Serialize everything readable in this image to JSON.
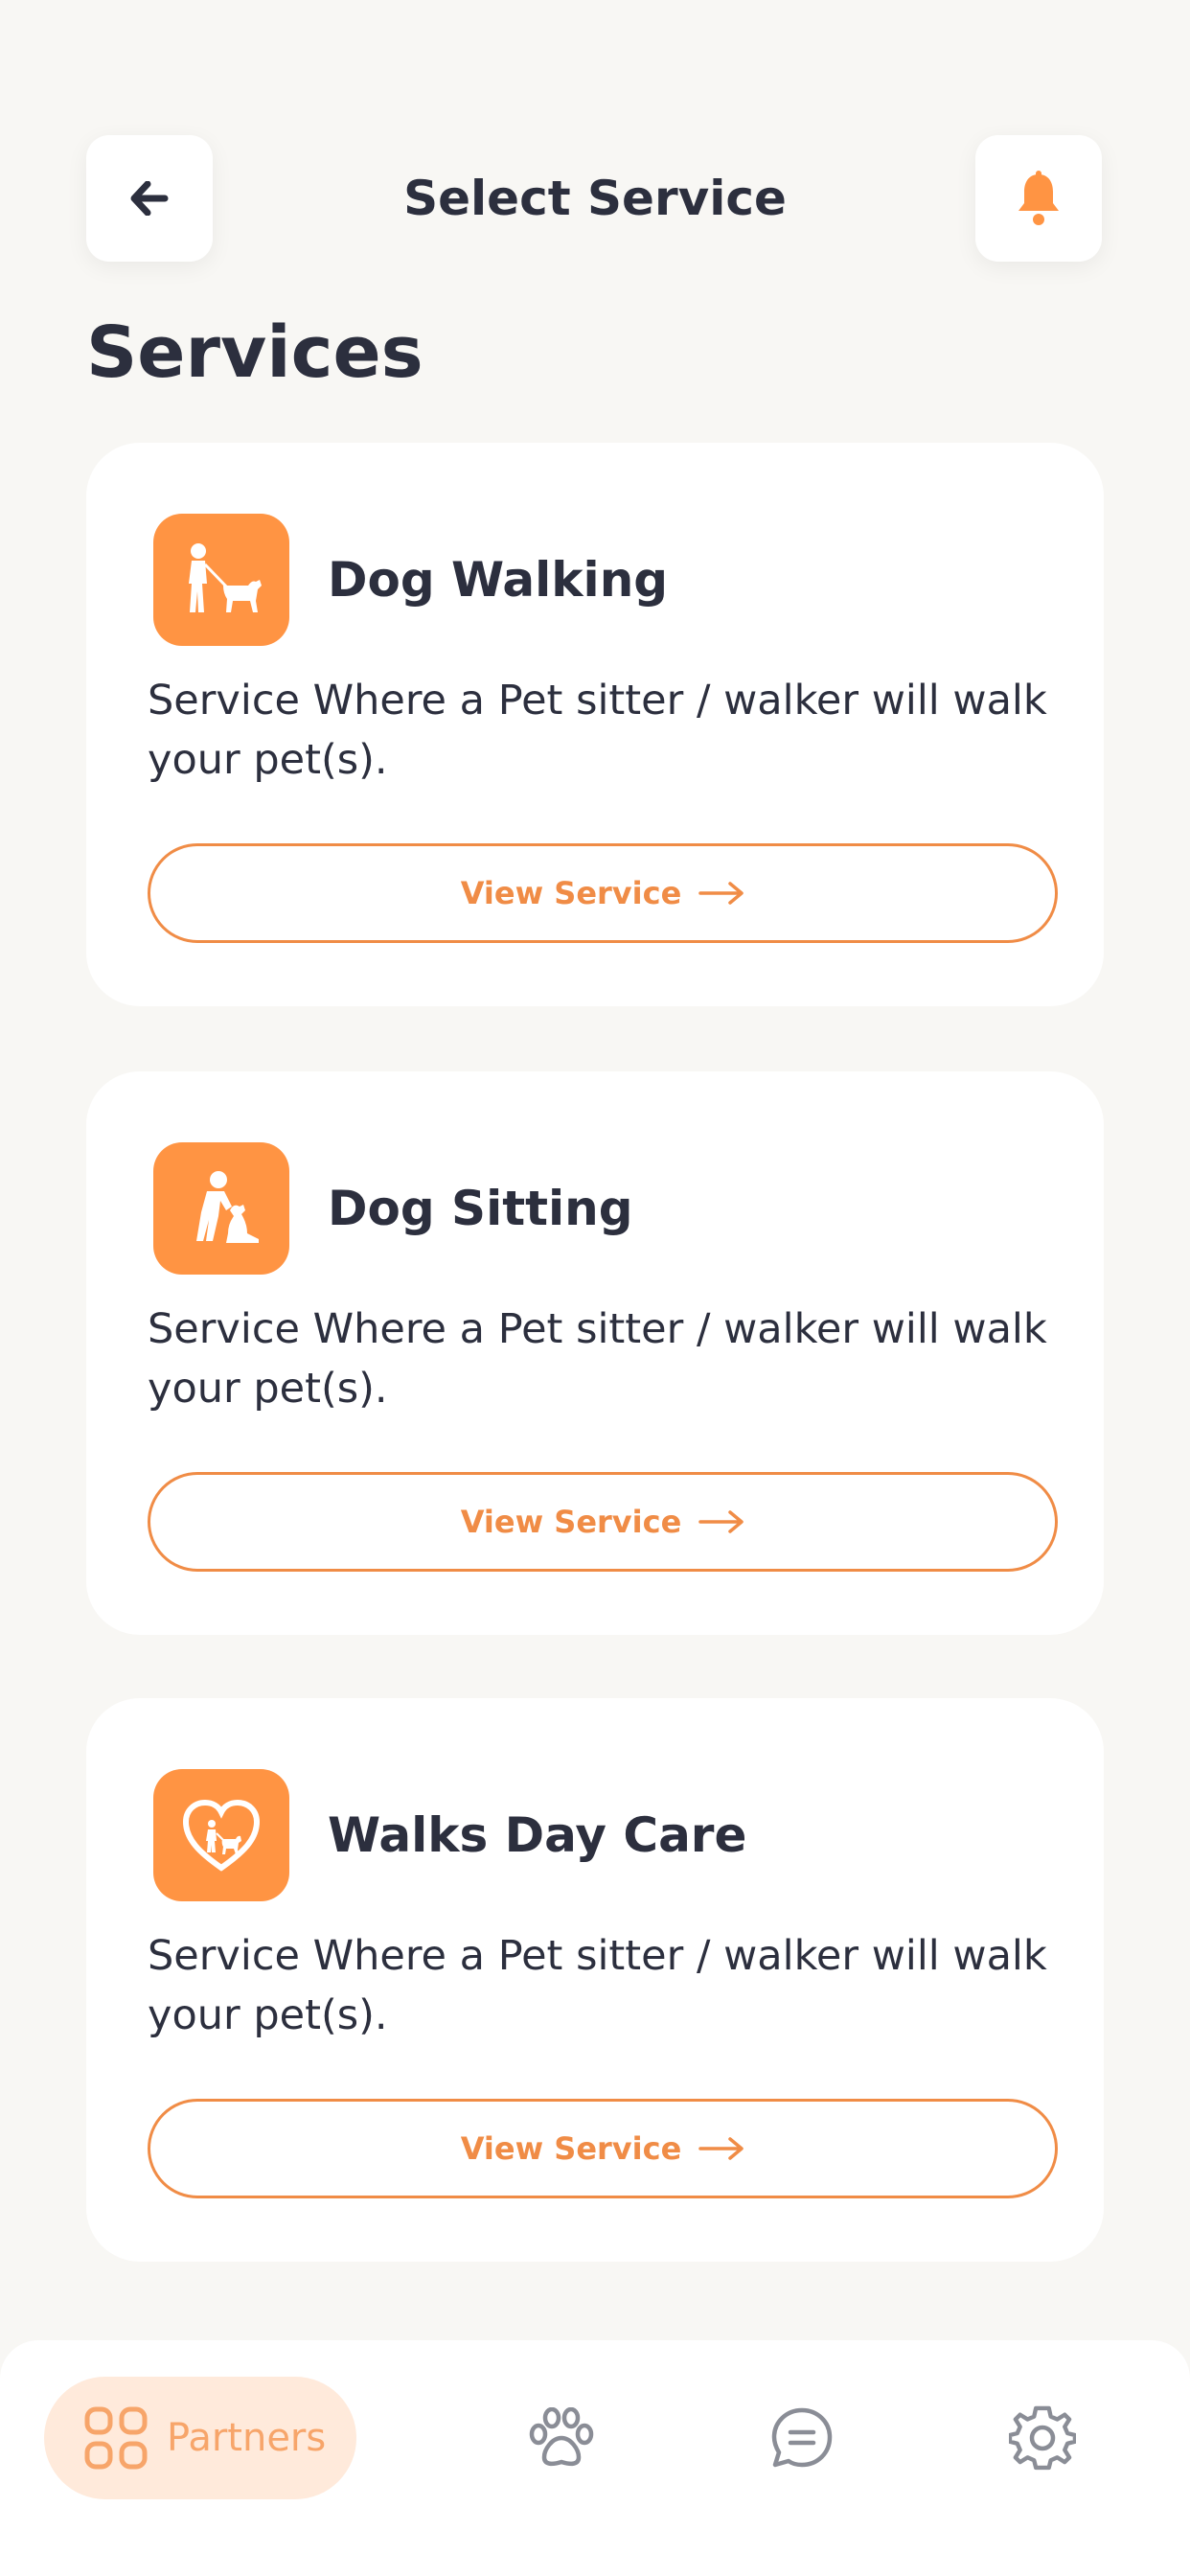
{
  "header": {
    "title": "Select Service",
    "back_icon": "arrow-left-icon",
    "bell_icon": "bell-icon"
  },
  "section_title": "Services",
  "services": [
    {
      "title": "Dog Walking",
      "icon": "dog-walking-icon",
      "description": "Service Where a Pet sitter / walker will walk your pet(s).",
      "button_label": "View Service"
    },
    {
      "title": "Dog Sitting",
      "icon": "dog-sitting-icon",
      "description": "Service Where a Pet sitter / walker will walk your pet(s).",
      "button_label": "View Service"
    },
    {
      "title": "Walks Day Care",
      "icon": "heart-dog-icon",
      "description": "Service Where a Pet sitter / walker will walk your pet(s).",
      "button_label": "View Service"
    }
  ],
  "bottom_nav": {
    "active_label": "Partners",
    "items": [
      "grid-icon",
      "paw-icon",
      "chat-icon",
      "settings-icon"
    ]
  },
  "colors": {
    "accent": "#ff9443",
    "background": "#f8f7f4",
    "text": "#2c2f3e",
    "nav_active_bg": "#ffeadb"
  }
}
